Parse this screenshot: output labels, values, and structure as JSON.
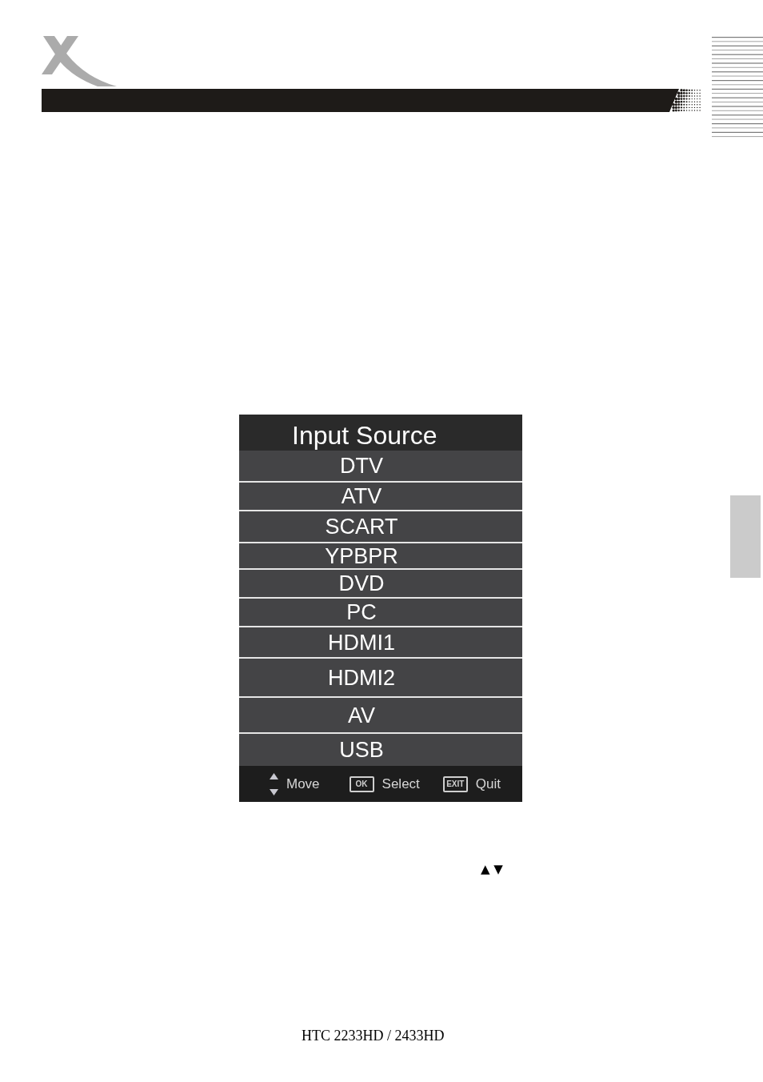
{
  "menu": {
    "title": "Input Source",
    "items": [
      {
        "label": "DTV"
      },
      {
        "label": "ATV"
      },
      {
        "label": "SCART"
      },
      {
        "label": "YPBPR"
      },
      {
        "label": "DVD"
      },
      {
        "label": "PC"
      },
      {
        "label": "HDMI1"
      },
      {
        "label": "HDMI2"
      },
      {
        "label": "AV"
      },
      {
        "label": "USB"
      }
    ],
    "hints": [
      {
        "kind": "move",
        "label": "Move"
      },
      {
        "kind": "key",
        "key": "OK",
        "label": "Select"
      },
      {
        "kind": "key",
        "key": "EXIT",
        "label": "Quit"
      }
    ]
  },
  "navigation_arrows": "▲ ▼",
  "footer": {
    "model": "HTC 2233HD / 2433HD"
  }
}
